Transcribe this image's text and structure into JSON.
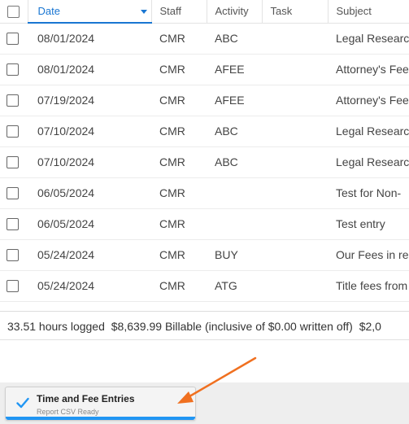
{
  "table": {
    "columns": {
      "date": "Date",
      "staff": "Staff",
      "activity": "Activity",
      "task": "Task",
      "subject": "Subject"
    },
    "sort": {
      "column": "date",
      "direction": "descending"
    },
    "rows": [
      {
        "date": "08/01/2024",
        "staff": "CMR",
        "activity": "ABC",
        "task": "",
        "subject": "Legal Research"
      },
      {
        "date": "08/01/2024",
        "staff": "CMR",
        "activity": "AFEE",
        "task": "",
        "subject": "Attorney's Fee"
      },
      {
        "date": "07/19/2024",
        "staff": "CMR",
        "activity": "AFEE",
        "task": "",
        "subject": "Attorney's Fee"
      },
      {
        "date": "07/10/2024",
        "staff": "CMR",
        "activity": "ABC",
        "task": "",
        "subject": "Legal Research"
      },
      {
        "date": "07/10/2024",
        "staff": "CMR",
        "activity": "ABC",
        "task": "",
        "subject": "Legal Research"
      },
      {
        "date": "06/05/2024",
        "staff": "CMR",
        "activity": "",
        "task": "",
        "subject": "Test for Non-"
      },
      {
        "date": "06/05/2024",
        "staff": "CMR",
        "activity": "",
        "task": "",
        "subject": "Test entry"
      },
      {
        "date": "05/24/2024",
        "staff": "CMR",
        "activity": "BUY",
        "task": "",
        "subject": "Our Fees in re"
      },
      {
        "date": "05/24/2024",
        "staff": "CMR",
        "activity": "ATG",
        "task": "",
        "subject": "Title fees from"
      }
    ]
  },
  "summary": {
    "hours": "33.51 hours logged",
    "billable": "$8,639.99 Billable (inclusive of $0.00 written off)",
    "more": "$2,0"
  },
  "toast": {
    "title": "Time and Fee Entries",
    "subtitle": "Report CSV Ready",
    "icon": "check-icon",
    "accent": "#2196f3"
  },
  "annotation": {
    "arrow_color": "#f07020"
  },
  "colors": {
    "sort_active": "#1976d2",
    "footer_bg": "#eeeeee"
  }
}
